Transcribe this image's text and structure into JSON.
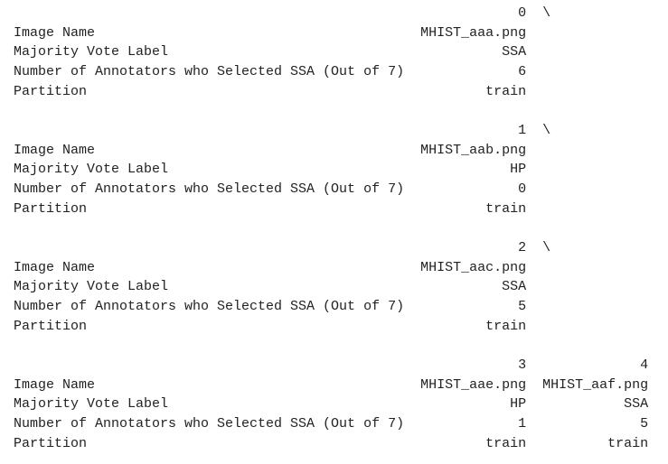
{
  "row_labels": [
    "Image Name",
    "Majority Vote Label",
    "Number of Annotators who Selected SSA (Out of 7)",
    "Partition"
  ],
  "continuation_marker": "\\",
  "blocks": [
    {
      "columns": [
        {
          "header": "0",
          "values": [
            "MHIST_aaa.png",
            "SSA",
            "6",
            "train"
          ]
        }
      ],
      "continued": true
    },
    {
      "columns": [
        {
          "header": "1",
          "values": [
            "MHIST_aab.png",
            "HP",
            "0",
            "train"
          ]
        }
      ],
      "continued": true
    },
    {
      "columns": [
        {
          "header": "2",
          "values": [
            "MHIST_aac.png",
            "SSA",
            "5",
            "train"
          ]
        }
      ],
      "continued": true
    },
    {
      "columns": [
        {
          "header": "3",
          "values": [
            "MHIST_aae.png",
            "HP",
            "1",
            "train"
          ]
        },
        {
          "header": "4",
          "values": [
            "MHIST_aaf.png",
            "SSA",
            "5",
            "train"
          ]
        }
      ],
      "continued": false
    }
  ]
}
